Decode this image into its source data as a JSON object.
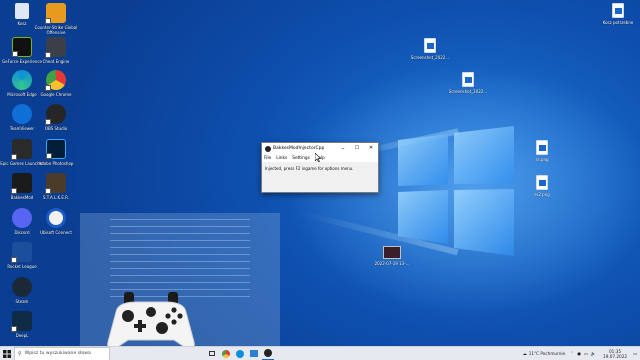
{
  "desktop": {
    "icons_left": [
      {
        "label": "Kosz",
        "kind": "recycle"
      },
      {
        "label": "Counter-Strike Global Offensive",
        "kind": "csgo"
      },
      {
        "label": "GeForce Experience",
        "kind": "nvidia"
      },
      {
        "label": "Cheat Engine",
        "kind": "cheat"
      },
      {
        "label": "Microsoft Edge",
        "kind": "edge"
      },
      {
        "label": "Google Chrome",
        "kind": "chrome"
      },
      {
        "label": "TeamViewer",
        "kind": "teamviewer"
      },
      {
        "label": "OBS Studio",
        "kind": "obs"
      },
      {
        "label": "Epic Games Launcher",
        "kind": "epic"
      },
      {
        "label": "Adobe Photoshop",
        "kind": "ps"
      },
      {
        "label": "BakkesMod",
        "kind": "bakkes"
      },
      {
        "label": "S.T.A.L.K.E.R.",
        "kind": "stalker"
      },
      {
        "label": "Discord",
        "kind": "discord"
      },
      {
        "label": "Ubisoft Connect",
        "kind": "ubisoft"
      },
      {
        "label": "Rocket League",
        "kind": "rocket"
      },
      {
        "label": "Steam",
        "kind": "steam"
      },
      {
        "label": "DeepL",
        "kind": "deepl"
      }
    ],
    "icons_right": [
      {
        "label": "Kosz potrzebne",
        "kind": "file"
      },
      {
        "label": "Screenshot_2022...",
        "kind": "file"
      },
      {
        "label": "Screenshot_2022...",
        "kind": "file"
      },
      {
        "label": "ss.png",
        "kind": "file"
      },
      {
        "label": "ss2.png",
        "kind": "file"
      },
      {
        "label": "2022-07-19 13-...",
        "kind": "video"
      }
    ]
  },
  "app_window": {
    "title": "BakkesModInjectorCpp",
    "controls": {
      "minimize": "–",
      "maximize": "☐",
      "close": "✕"
    },
    "menu": [
      "File",
      "Links",
      "Settings",
      "Help"
    ],
    "status_text": "Injected, press F2 ingame for options menu."
  },
  "taskbar": {
    "search_placeholder": "Wpisz tu wyszukiwane słowa",
    "weather": "11°C Pochmurnie",
    "time": "01:35",
    "date": "19.07.2022"
  },
  "colors": {
    "desktop": "#0e4fae",
    "taskbar": "#e6eaf0",
    "accent": "#1a66c9"
  }
}
